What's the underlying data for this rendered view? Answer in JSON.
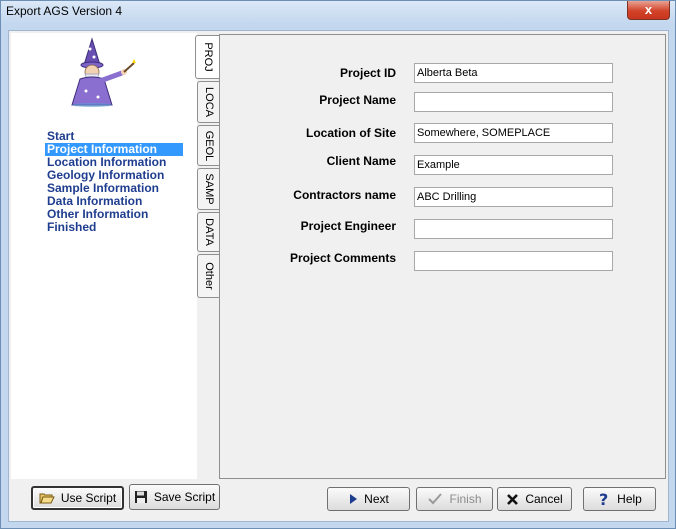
{
  "window": {
    "title": "Export AGS Version 4",
    "close_glyph": "x"
  },
  "steps": [
    {
      "label": "Start",
      "active": false
    },
    {
      "label": "Project Information",
      "active": true
    },
    {
      "label": "Location Information",
      "active": false
    },
    {
      "label": "Geology Information",
      "active": false
    },
    {
      "label": "Sample Information",
      "active": false
    },
    {
      "label": "Data Information",
      "active": false
    },
    {
      "label": "Other Information",
      "active": false
    },
    {
      "label": "Finished",
      "active": false
    }
  ],
  "tabs": [
    {
      "label": "PROJ",
      "active": true
    },
    {
      "label": "LOCA",
      "active": false
    },
    {
      "label": "GEOL",
      "active": false
    },
    {
      "label": "SAMP",
      "active": false
    },
    {
      "label": "DATA",
      "active": false
    },
    {
      "label": "Other",
      "active": false
    }
  ],
  "form": {
    "project_id": {
      "label": "Project ID",
      "value": "Alberta Beta"
    },
    "project_name": {
      "label": "Project Name",
      "value": ""
    },
    "location": {
      "label": "Location of Site",
      "value": "Somewhere, SOMEPLACE"
    },
    "client": {
      "label": "Client Name",
      "value": "Example"
    },
    "contractor": {
      "label": "Contractors name",
      "value": "ABC Drilling"
    },
    "engineer": {
      "label": "Project Engineer",
      "value": ""
    },
    "comments": {
      "label": "Project Comments",
      "value": ""
    }
  },
  "buttons": {
    "use_script": "Use Script",
    "save_script": "Save Script",
    "next": "Next",
    "finish": "Finish",
    "cancel": "Cancel",
    "help": "Help"
  },
  "icons": {
    "folder": "folder-open-icon",
    "disk": "floppy-disk-icon",
    "next": "play-arrow-icon",
    "finish": "checkmark-icon",
    "cancel": "x-mark-icon",
    "help": "question-mark-icon"
  }
}
